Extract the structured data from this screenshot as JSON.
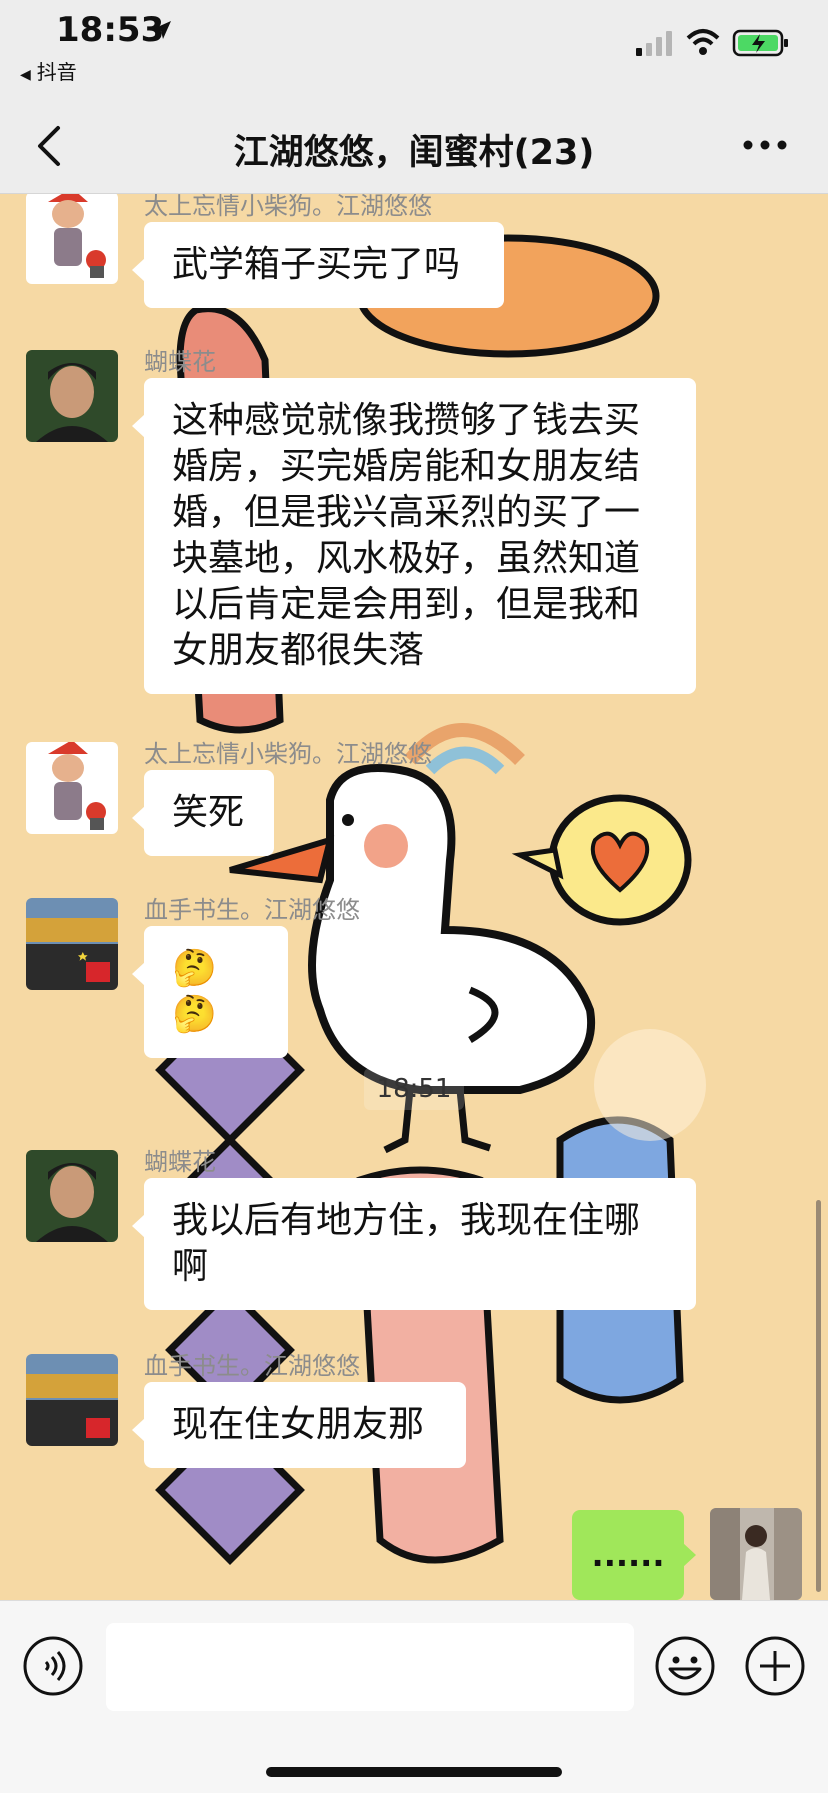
{
  "status_bar": {
    "time": "18:53",
    "back_app": "抖音"
  },
  "nav": {
    "title": "江湖悠悠，闺蜜村(23)"
  },
  "messages": [
    {
      "sender": "太上忘情小柴狗。江湖悠悠",
      "text": "武学箱子买完了吗",
      "avatar": "avatar-xiaochaigou"
    },
    {
      "sender": "蝴蝶花",
      "text": "这种感觉就像我攒够了钱去买婚房，买完婚房能和女朋友结婚，但是我兴高采烈的买了一块墓地，风水极好，虽然知道以后肯定是会用到，但是我和女朋友都很失落",
      "avatar": "avatar-hudiehua"
    },
    {
      "sender": "太上忘情小柴狗。江湖悠悠",
      "text": "笑死",
      "avatar": "avatar-xiaochaigou"
    },
    {
      "sender": "血手书生。江湖悠悠",
      "text": "🤔🤔",
      "avatar": "avatar-xueshoushusheng"
    },
    {
      "sender": "蝴蝶花",
      "text": "我以后有地方住，我现在住哪啊",
      "avatar": "avatar-hudiehua"
    },
    {
      "sender": "血手书生。江湖悠悠",
      "text": "现在住女朋友那",
      "avatar": "avatar-xueshoushusheng"
    }
  ],
  "timestamp": "18:51",
  "my_message": {
    "text": "......"
  },
  "input": {
    "value": ""
  },
  "icons": {
    "voice": "voice-icon",
    "emoji": "emoji-icon",
    "plus": "plus-icon"
  },
  "colors": {
    "chat_bg": "#f6d9a4",
    "my_bubble": "#a0e75a",
    "other_bubble": "#ffffff"
  }
}
